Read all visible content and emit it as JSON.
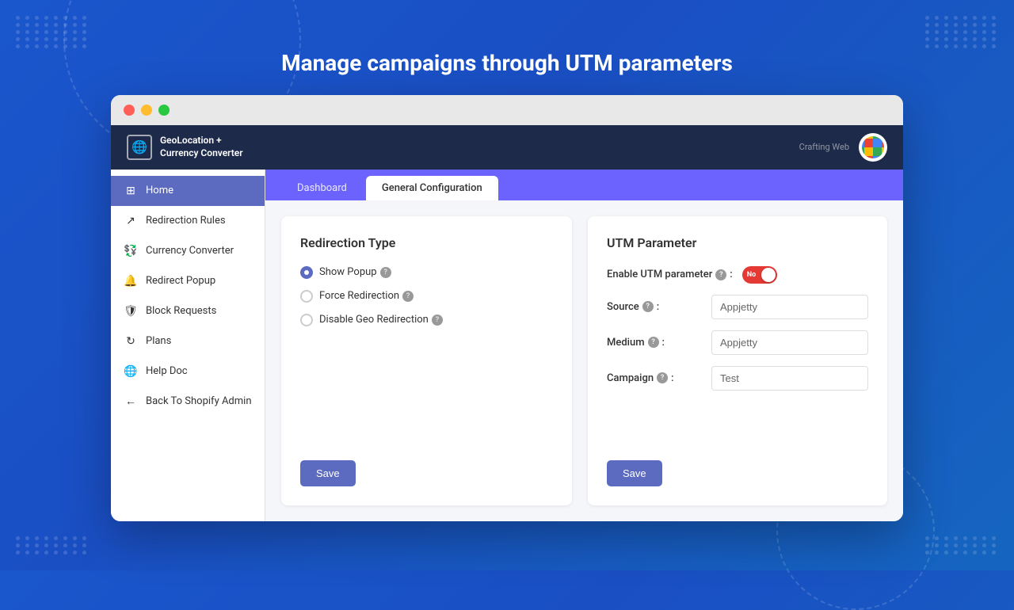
{
  "page": {
    "title": "Manage campaigns through UTM parameters"
  },
  "browser": {
    "dots": [
      "red",
      "yellow",
      "green"
    ]
  },
  "header": {
    "logo_icon": "🌐",
    "app_name": "GeoLocation +\nCurrency Converter",
    "crafting_web": "Crafting Web",
    "badge_alt": "app-badge"
  },
  "sidebar": {
    "items": [
      {
        "id": "home",
        "icon": "⊞",
        "label": "Home",
        "active": true
      },
      {
        "id": "redirection-rules",
        "icon": "↗",
        "label": "Redirection Rules",
        "active": false
      },
      {
        "id": "currency-converter",
        "icon": "💱",
        "label": "Currency Converter",
        "active": false
      },
      {
        "id": "redirect-popup",
        "icon": "🔔",
        "label": "Redirect Popup",
        "active": false
      },
      {
        "id": "block-requests",
        "icon": "🛡",
        "label": "Block Requests",
        "active": false
      },
      {
        "id": "plans",
        "icon": "↻",
        "label": "Plans",
        "active": false
      },
      {
        "id": "help-doc",
        "icon": "🌐",
        "label": "Help Doc",
        "active": false
      },
      {
        "id": "back-to-shopify",
        "icon": "←",
        "label": "Back To Shopify Admin",
        "active": false
      }
    ]
  },
  "tabs": [
    {
      "id": "dashboard",
      "label": "Dashboard",
      "active": false
    },
    {
      "id": "general-configuration",
      "label": "General Configuration",
      "active": true
    }
  ],
  "redirection_card": {
    "title": "Redirection Type",
    "options": [
      {
        "id": "show-popup",
        "label": "Show Popup",
        "selected": true
      },
      {
        "id": "force-redirection",
        "label": "Force Redirection",
        "selected": false
      },
      {
        "id": "disable-geo-redirection",
        "label": "Disable Geo Redirection",
        "selected": false
      }
    ],
    "save_button": "Save"
  },
  "utm_card": {
    "title": "UTM Parameter",
    "enable_label": "Enable UTM parameter",
    "toggle_state": "No",
    "toggle_enabled": false,
    "fields": [
      {
        "id": "source",
        "label": "Source",
        "placeholder": "",
        "value": "Appjetty"
      },
      {
        "id": "medium",
        "label": "Medium",
        "placeholder": "",
        "value": "Appjetty"
      },
      {
        "id": "campaign",
        "label": "Campaign",
        "placeholder": "",
        "value": "Test"
      }
    ],
    "save_button": "Save"
  }
}
